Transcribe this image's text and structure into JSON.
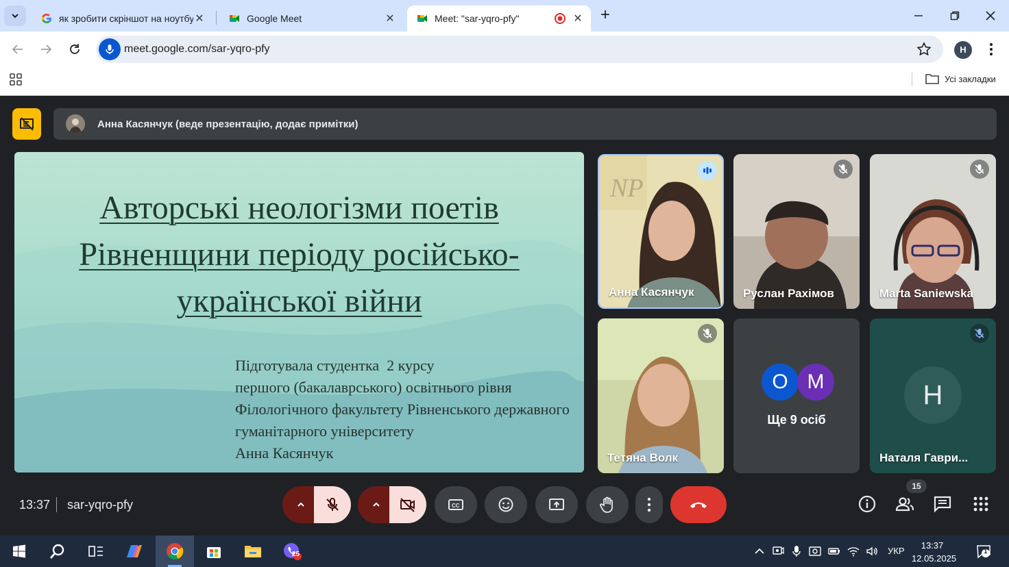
{
  "browser": {
    "tabs": [
      {
        "title": "як зробити скріншот на ноутбу",
        "active": false
      },
      {
        "title": "Google Meet",
        "active": false
      },
      {
        "title": "Meet: \"sar-yqro-pfy\"",
        "active": true
      }
    ],
    "url": "meet.google.com/sar-yqro-pfy",
    "profile_initial": "H",
    "bookmarks_all_label": "Усі закладки"
  },
  "meet": {
    "presenter_banner": "Анна Касянчук (веде презентацію, додає примітки)",
    "slide": {
      "title_lines": [
        "Авторські неологізми поетів",
        "Рівненщини періоду російсько-",
        "української війни"
      ],
      "subtitle_lines": [
        "Підготувала студентка  2 курсу",
        "першого (бакалаврського) освітнього рівня",
        "Філологічного факультету Рівненського державного",
        "гуманітарного університету",
        "Анна Касянчук"
      ]
    },
    "participants": [
      {
        "name": "Анна Касянчук",
        "speaking": true
      },
      {
        "name": "Руслан Рахімов",
        "muted": true
      },
      {
        "name": "Marta Saniewska",
        "muted": true
      },
      {
        "name": "Тетяна Волк",
        "muted": true
      },
      {
        "name": "Наталя Гаври...",
        "initial": "Н",
        "muted": true
      }
    ],
    "more_tile": {
      "avatars": [
        "O",
        "M"
      ],
      "label": "Ще 9 осіб"
    },
    "time": "13:37",
    "meeting_code": "sar-yqro-pfy",
    "people_count": "15"
  },
  "taskbar": {
    "viber_badge": "25",
    "language": "УКР",
    "time": "13:37",
    "date": "12.05.2025",
    "notification_count": "1"
  },
  "colors": {
    "accent_blue": "#0b57d0",
    "hangup_red": "#dc362e",
    "present_yellow": "#fbbc04",
    "meet_bg": "#202124"
  }
}
